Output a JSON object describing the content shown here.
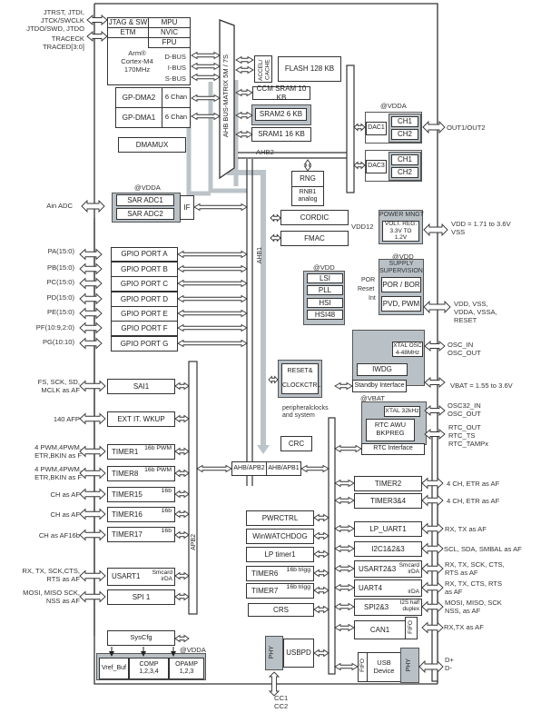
{
  "debug": {
    "jtag_pins": [
      "JTRST, JTDI,",
      "JTCK/SWCLK",
      "JTDO/SWD, JTDO"
    ],
    "trace_pins": [
      "TRACECK",
      "TRACED[3:0]"
    ]
  },
  "core": {
    "jtag": "JTAG & SW",
    "etm": "ETM",
    "mpu": "MPU",
    "nvic": "NVIC",
    "fpu": "FPU",
    "name": "Arm®",
    "model": "Cortex-M4",
    "freq": "170MHz",
    "dbus": "D-BUS",
    "ibus": "I-BUS",
    "sbus": "S-BUS"
  },
  "dma": {
    "dma2": "GP-DMA2",
    "dma1": "GP-DMA1",
    "chan2": "6 Chan",
    "chan1": "6 Chan",
    "dmamux": "DMAMUX"
  },
  "bus_matrix": "AHB BUS-MATRIX 5M / 7S",
  "memory": {
    "accel": "ACCEL/ CACHE",
    "flash": "FLASH 128 KB",
    "ccm": "CCM SRAM 10 KB",
    "sram2": "SRAM2 6 KB",
    "sram1": "SRAM1 16 KB"
  },
  "ahb2": "AHB2",
  "ahb1": "AHB1",
  "apb2": "APB2",
  "rng": {
    "rng": "RNG",
    "rnb": "RNB1 analog"
  },
  "dac": {
    "vdda": "@VDDA",
    "dac1": "DAC1",
    "dac3": "DAC3",
    "ch1": "CH1",
    "ch2": "CH2",
    "out": "OUT1/OUT2"
  },
  "adc": {
    "vdda": "@VDDA",
    "pin": "Ain ADC",
    "adc1": "SAR ADC1",
    "adc2": "SAR ADC2",
    "if": "IF"
  },
  "math": {
    "cordic": "CORDIC",
    "fmac": "FMAC"
  },
  "power": {
    "title": "POWER MNGT",
    "volt": "VOLT. REG. 3.3V TO 1.2V",
    "vdd12": "VDD12",
    "pins": [
      "VDD = 1.71 to 3.6V",
      "VSS"
    ]
  },
  "supply": {
    "vdd": "@VDD",
    "title": "SUPPLY SUPERVISION",
    "por": "POR / BOR",
    "pvd": "PVD, PWM",
    "por_lbl": "POR",
    "reset_lbl": "Reset",
    "int_lbl": "Int",
    "pins": [
      "VDD, VSS,",
      "VDDA, VSSA,",
      "RESET"
    ]
  },
  "gpio": {
    "ports": [
      {
        "pin": "PA(15:0)",
        "name": "GPIO PORT A"
      },
      {
        "pin": "PB(15:0)",
        "name": "GPIO PORT B"
      },
      {
        "pin": "PC(15:0)",
        "name": "GPIO PORT C"
      },
      {
        "pin": "PD(15:0)",
        "name": "GPIO PORT D"
      },
      {
        "pin": "PE(15:0)",
        "name": "GPIO PORT E"
      },
      {
        "pin": "PF(10:9,2:0)",
        "name": "GPIO PORT F"
      },
      {
        "pin": "PG(10:10)",
        "name": "GPIO PORT G"
      }
    ]
  },
  "clocks": {
    "vdd": "@VDD",
    "lsi": "LSI",
    "pll": "PLL",
    "hsi": "HSI",
    "hsi48": "HSI48",
    "rcc1": "RESET&",
    "rcc2": "CLOCKCTRL",
    "periph": "peripheralclocks and system",
    "xtal": "XTAL OSC 4-48MHz",
    "iwdg": "IWDG",
    "standby": "Standby Interface",
    "osc_pins": [
      "OSC_IN",
      "OSC_OUT"
    ],
    "vbat_pin": "VBAT = 1.55 to 3.6V"
  },
  "rtc": {
    "vbat": "@VBAT",
    "xtal32": "XTAL 32kHz",
    "awu": "RTC AWU",
    "bkpreg": "BKPREG",
    "iface": "RTC Interface",
    "osc32": [
      "OSC32_IN",
      "OSC_OUT"
    ],
    "pins": [
      "RTC_OUT",
      "RTC_TS",
      "RTC_TAMPx"
    ]
  },
  "crc": "CRC",
  "bridges": {
    "apb2": "AHB/APB2",
    "apb1": "AHB/APB1"
  },
  "apb2_periph": [
    {
      "pin": "FS, SCK, SD, MCLK as AF",
      "name": "SAI1",
      "tag": ""
    },
    {
      "pin": "140 AFP",
      "name": "EXT IT. WKUP",
      "tag": ""
    },
    {
      "pin": "4 PWM,4PWM, ETR,BKIN as F",
      "name": "TIMER1",
      "tag": "16b PWM"
    },
    {
      "pin": "4 PWM,4PWM, ETR,BKIN as F",
      "name": "TIMER8",
      "tag": "16b PWM"
    },
    {
      "pin": "CH as AF",
      "name": "TIMER15",
      "tag": "16b"
    },
    {
      "pin": "CH as AF",
      "name": "TIMER16",
      "tag": "16b"
    },
    {
      "pin": "CH as AF16b",
      "name": "TIMER17",
      "tag": "16b"
    },
    {
      "pin": "RX, TX, SCK,CTS, RTS as AF",
      "name": "USART1",
      "tag": "Smcard irDA"
    },
    {
      "pin": "MOSI, MISO SCK, NSS as AF",
      "name": "SPI 1",
      "tag": ""
    }
  ],
  "syscfg": "SysCfg",
  "analog": {
    "vdda": "@VDDA",
    "vref": "Vref_Buf",
    "comp": "COMP 1,2,3,4",
    "opamp": "OPAMP 1,2,3"
  },
  "apb1_left": [
    {
      "name": "PWRCTRL",
      "tag": ""
    },
    {
      "name": "WinWATCHDOG",
      "tag": ""
    },
    {
      "name": "LP timer1",
      "tag": ""
    },
    {
      "name": "TIMER6",
      "tag": "16b trigg"
    },
    {
      "name": "TIMER7",
      "tag": "16b trigg"
    },
    {
      "name": "CRS",
      "tag": ""
    }
  ],
  "usbpd": {
    "phy": "PHY",
    "name": "USBPD",
    "pins": [
      "CC1",
      "CC2"
    ]
  },
  "apb1_right": [
    {
      "name": "TIMER2",
      "tag": "",
      "pin": "4 CH, ETR as AF"
    },
    {
      "name": "TIMER3&4",
      "tag": "",
      "pin": "4 CH, ETR as AF"
    },
    {
      "name": "LP_UART1",
      "tag": "",
      "pin": "RX, TX as AF"
    },
    {
      "name": "I2C1&2&3",
      "tag": "",
      "pin": "SCL, SDA, SMBAL as AF"
    },
    {
      "name": "USART2&3",
      "tag": "Smcard irDA",
      "pin": "RX, TX, SCK, CTS, RTS as AF"
    },
    {
      "name": "UART4",
      "tag": "irDA",
      "pin": "RX, TX, CTS, RTS as AF"
    },
    {
      "name": "SPI2&3",
      "tag": "I2S half duplex",
      "pin": "MOSI, MISO, SCK NSS, as AF"
    },
    {
      "name": "CAN1",
      "tag": "FIFO",
      "pin": "RX,TX as AF"
    }
  ],
  "usb": {
    "fifo": "FIFO",
    "name": "USB Device",
    "phy": "PHY",
    "pins": [
      "D+",
      "D-"
    ]
  }
}
